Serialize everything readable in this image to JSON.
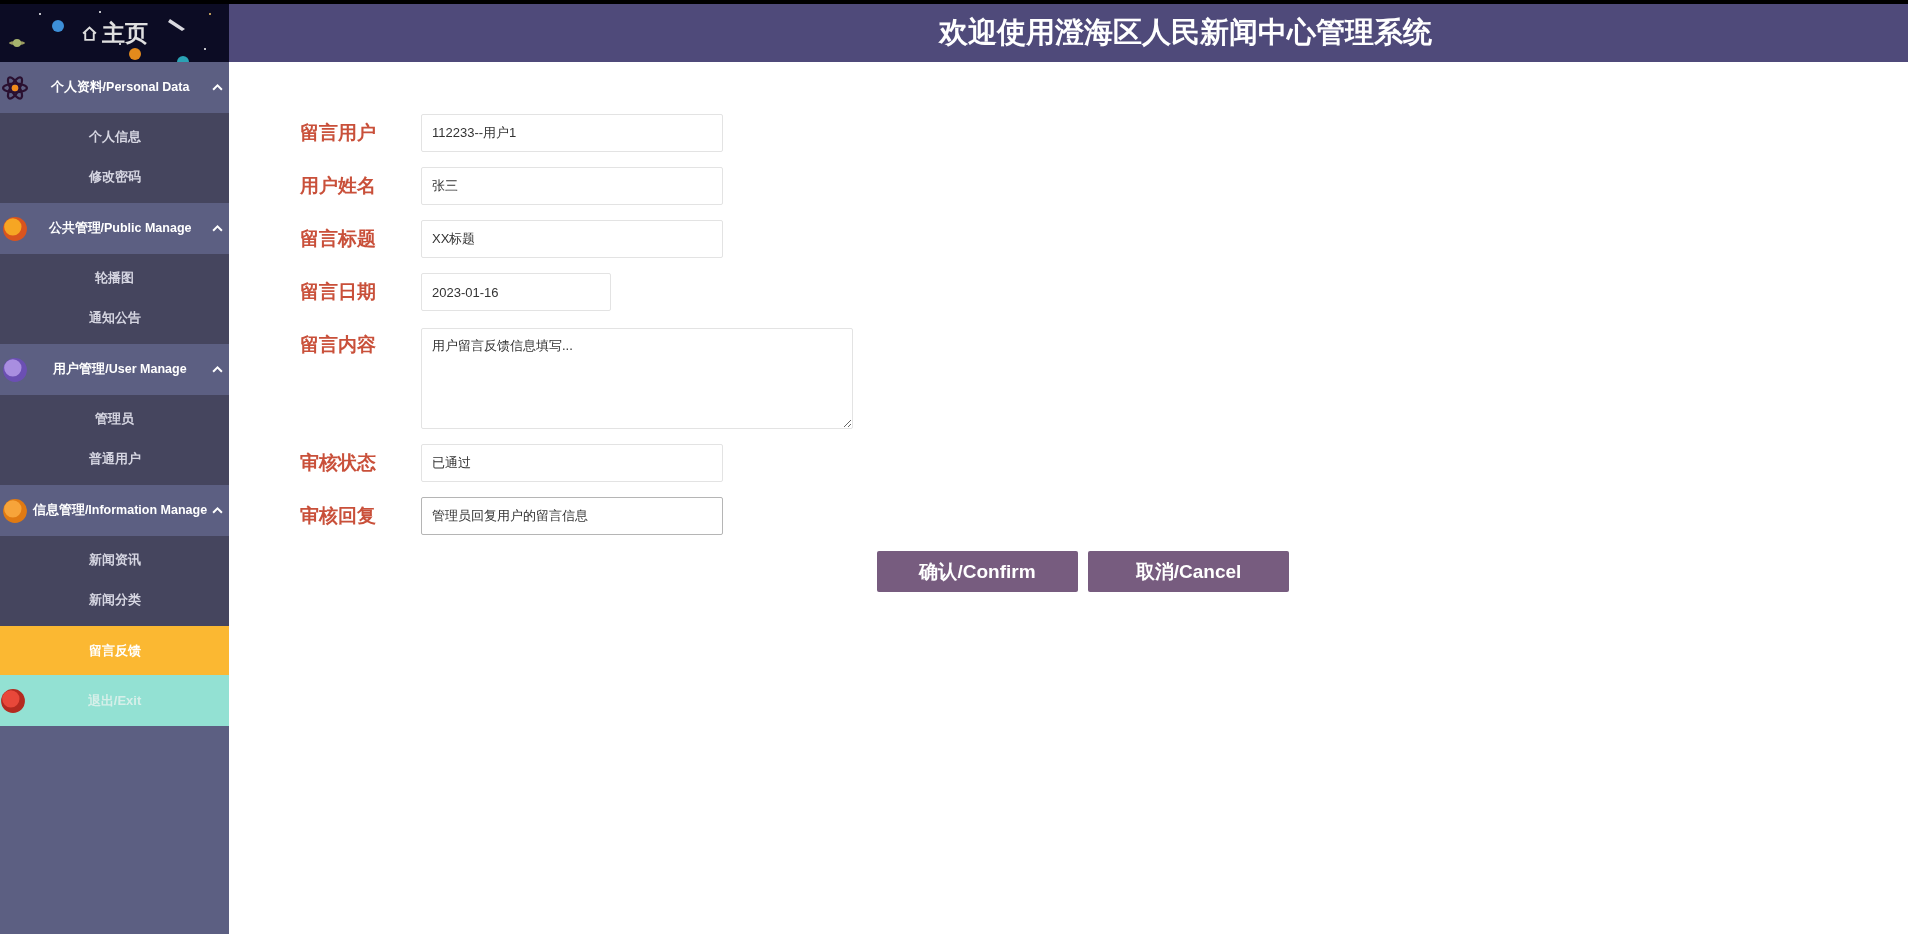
{
  "header": {
    "title": "欢迎使用澄海区人民新闻中心管理系统"
  },
  "sidebar": {
    "home": {
      "label": "主页"
    },
    "menu": [
      {
        "kind": "group",
        "label": "个人资料/Personal Data",
        "expanded": true,
        "items": [
          {
            "label": "个人信息",
            "selected": false
          },
          {
            "label": "修改密码",
            "selected": false
          }
        ]
      },
      {
        "kind": "group",
        "label": "公共管理/Public Manage",
        "expanded": true,
        "items": [
          {
            "label": "轮播图",
            "selected": false
          },
          {
            "label": "通知公告",
            "selected": false
          }
        ]
      },
      {
        "kind": "group",
        "label": "用户管理/User Manage",
        "expanded": true,
        "items": [
          {
            "label": "管理员",
            "selected": false
          },
          {
            "label": "普通用户",
            "selected": false
          }
        ]
      },
      {
        "kind": "group",
        "label": "信息管理/Information Manage",
        "expanded": true,
        "items": [
          {
            "label": "新闻资讯",
            "selected": false
          },
          {
            "label": "新闻分类",
            "selected": false
          }
        ]
      },
      {
        "kind": "link",
        "label": "留言反馈",
        "selected": true
      },
      {
        "kind": "exit",
        "label": "退出/Exit",
        "selected": false
      }
    ]
  },
  "form": {
    "fields": [
      {
        "label": "留言用户",
        "kind": "input",
        "value": "112233--用户1",
        "focused": false
      },
      {
        "label": "用户姓名",
        "kind": "input",
        "value": "张三",
        "focused": false
      },
      {
        "label": "留言标题",
        "kind": "input",
        "value": "XX标题",
        "focused": false
      },
      {
        "label": "留言日期",
        "kind": "date",
        "value": "2023-01-16",
        "focused": false
      },
      {
        "label": "留言内容",
        "kind": "textarea",
        "value": "用户留言反馈信息填写...",
        "focused": false
      },
      {
        "label": "审核状态",
        "kind": "input",
        "value": "已通过",
        "focused": false
      },
      {
        "label": "审核回复",
        "kind": "input",
        "value": "管理员回复用户的留言信息",
        "focused": true
      }
    ],
    "buttons": [
      {
        "label": "确认/Confirm"
      },
      {
        "label": "取消/Cancel"
      }
    ]
  }
}
